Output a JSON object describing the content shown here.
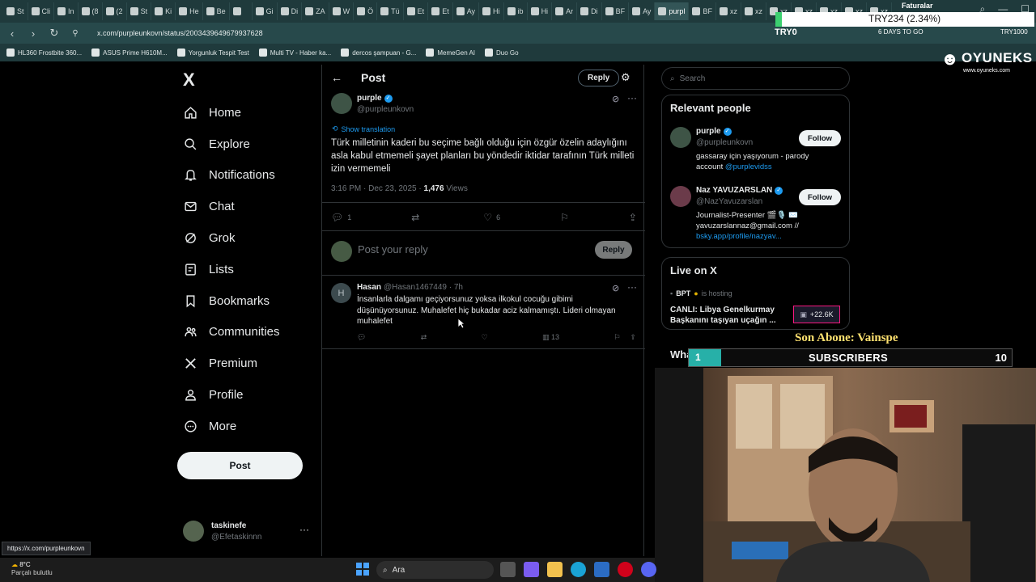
{
  "browser": {
    "tabs": [
      "St",
      "Cli",
      "In",
      "(8",
      "(2",
      "St",
      "Ki",
      "He",
      "Be",
      "",
      "Gi",
      "Di",
      "ZA",
      "W",
      "Ö",
      "Tü",
      "Et",
      "Et",
      "Ay",
      "Hi",
      "ib",
      "Hi",
      "Ar",
      "Di",
      "BF",
      "Ay",
      "purpl",
      "BF",
      "xz",
      "xz",
      "xz",
      "xz",
      "xz",
      "xz",
      "xz"
    ],
    "active_tab_index": 26,
    "url": "x.com/purpleunkovn/status/2003439649679937628",
    "bookmarks": [
      "HL360 Frostbite 360...",
      "ASUS Prime H610M...",
      "Yorgunluk Tespit Test",
      "Multi TV - Haber ka...",
      "dercos şampuan - G...",
      "MemeGen AI",
      "Duo Go"
    ],
    "status_url": "https://x.com/purpleunkovn"
  },
  "nav": {
    "logo": "X",
    "items": [
      {
        "label": "Home",
        "icon": "home-icon"
      },
      {
        "label": "Explore",
        "icon": "search-icon"
      },
      {
        "label": "Notifications",
        "icon": "bell-icon"
      },
      {
        "label": "Chat",
        "icon": "mail-icon"
      },
      {
        "label": "Grok",
        "icon": "grok-icon"
      },
      {
        "label": "Lists",
        "icon": "list-icon"
      },
      {
        "label": "Bookmarks",
        "icon": "bookmark-icon"
      },
      {
        "label": "Communities",
        "icon": "communities-icon"
      },
      {
        "label": "Premium",
        "icon": "x-icon"
      },
      {
        "label": "Profile",
        "icon": "person-icon"
      },
      {
        "label": "More",
        "icon": "more-circle-icon"
      }
    ],
    "post_button": "Post",
    "account": {
      "name": "taskinefe",
      "handle": "@Efetaskinnn"
    }
  },
  "main": {
    "title": "Post",
    "reply_label": "Reply",
    "post": {
      "name": "purple",
      "handle": "@purpleunkovn",
      "show_translation": "Show translation",
      "text": "Türk milletinin kaderi bu seçime bağlı olduğu için özgür özelin adaylığını asla kabul etmemeli şayet planları bu yöndedir iktidar tarafının Türk milleti izin vermemeli",
      "time": "3:16 PM · Dec 23, 2025 · ",
      "views_count": "1,476",
      "views_label": " Views",
      "replies": "1",
      "reposts": "",
      "likes": "6"
    },
    "reply_placeholder": "Post your reply",
    "reply_button": "Reply",
    "comment": {
      "avatar_letter": "H",
      "name": "Hasan",
      "handle": "@Hasan1467449 · 7h",
      "text": "İnsanlarla dalgamı geçiyorsunuz yoksa ilkokul cocuğu gibimi düşünüyorsunuz. Muhalefet hiç bukadar aciz kalmamıştı. Lideri olmayan muhalefet",
      "views": "13"
    }
  },
  "sidebar": {
    "search_placeholder": "Search",
    "relevant_title": "Relevant people",
    "people": [
      {
        "name": "purple",
        "handle": "@purpleunkovn",
        "bio": "gassaray için yaşıyorum - parody account ",
        "bio_link": "@purplevidss",
        "follow": "Follow"
      },
      {
        "name": "Naz YAVUZARSLAN",
        "handle": "@NazYavuzarslan",
        "bio": "Journalist-Presenter 🎬🎙️ ✉️ yavuzarslannaz@gmail.com // ",
        "bio_link": "bsky.app/profile/nazyav...",
        "follow": "Follow"
      }
    ],
    "live_title": "Live on X",
    "live": {
      "host": "BPT",
      "host_suffix": "is hosting",
      "title": "CANLI: Libya Genelkurmay Başkanını taşıyan uçağın ...",
      "count": "+22.6K"
    },
    "whats_happening": "What's happening"
  },
  "overlay": {
    "brand": "OYUNEKS",
    "brand_url": "www.oyuneks.com",
    "ticker_label": "Faturalar",
    "ticker": "TRY234 (2.34%)",
    "try_left": "TRY0",
    "days": "6 DAYS TO GO",
    "try_right": "TRY1000",
    "son_abone": "Son Abone: Vainspe",
    "subs_current": "1",
    "subs_label": "SUBSCRIBERS",
    "subs_goal": "10",
    "subs_fraction": 0.1
  },
  "taskbar": {
    "temp": "8°C",
    "weather": "Parçalı bulutlu",
    "search": "Ara"
  },
  "colors": {
    "accent": "#1d9bf0",
    "bg": "#000000",
    "muted": "#71767b",
    "sub_bar": "#27b0a8"
  }
}
